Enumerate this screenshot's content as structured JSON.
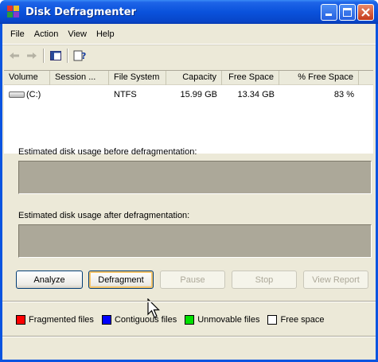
{
  "window": {
    "title": "Disk Defragmenter"
  },
  "menu": [
    "File",
    "Action",
    "View",
    "Help"
  ],
  "toolbar": {
    "back_icon": "back-arrow-icon",
    "forward_icon": "forward-arrow-icon",
    "console_tree_icon": "console-tree-icon",
    "help_icon": "help-icon"
  },
  "volumes": {
    "columns": [
      "Volume",
      "Session ...",
      "File System",
      "Capacity",
      "Free Space",
      "% Free Space"
    ],
    "rows": [
      {
        "volume": "(C:)",
        "session": "",
        "file_system": "NTFS",
        "capacity": "15.99 GB",
        "free_space": "13.34 GB",
        "percent_free": "83 %"
      }
    ]
  },
  "analysis": {
    "before_label": "Estimated disk usage before defragmentation:",
    "after_label": "Estimated disk usage after defragmentation:"
  },
  "buttons": {
    "analyze": "Analyze",
    "defragment": "Defragment",
    "pause": "Pause",
    "stop": "Stop",
    "view_report": "View Report"
  },
  "legend": [
    {
      "label": "Fragmented files",
      "color": "#ff0000"
    },
    {
      "label": "Contiguous files",
      "color": "#0000ff"
    },
    {
      "label": "Unmovable files",
      "color": "#00e000"
    },
    {
      "label": "Free space",
      "color": "#ffffff"
    }
  ]
}
